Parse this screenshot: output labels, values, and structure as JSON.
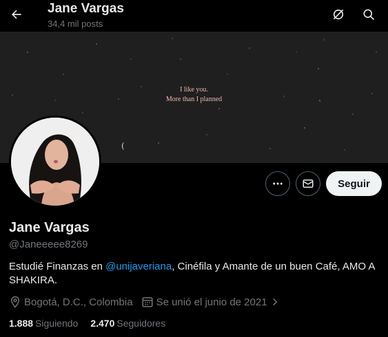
{
  "header": {
    "title": "Jane Vargas",
    "post_count": "34,4 mil posts",
    "icons": [
      "back-arrow-icon",
      "spaces-icon",
      "search-icon"
    ]
  },
  "banner": {
    "line1": "I like you.",
    "line2": "More than I planned"
  },
  "actions": {
    "more_icon": "more-icon",
    "message_icon": "envelope-icon",
    "follow_label": "Seguir"
  },
  "profile": {
    "name": "Jane Vargas",
    "handle": "@Janeeeee8269",
    "bio_before": "Estudié Finanzas en ",
    "bio_link": "@unijaveriana",
    "bio_after": ", Cinéfila y Amante de un buen Café, AMO A SHAKIRA.",
    "location": "Bogotá, D.C., Colombia",
    "joined": "Se unió el junio de 2021"
  },
  "stats": {
    "following_count": "1.888",
    "following_label": "Siguiendo",
    "followers_count": "2.470",
    "followers_label": "Seguidores"
  },
  "colors": {
    "background": "#000000",
    "link": "#1d9bf0",
    "secondary_text": "#71767b",
    "follow_button": "#eff3f4"
  }
}
